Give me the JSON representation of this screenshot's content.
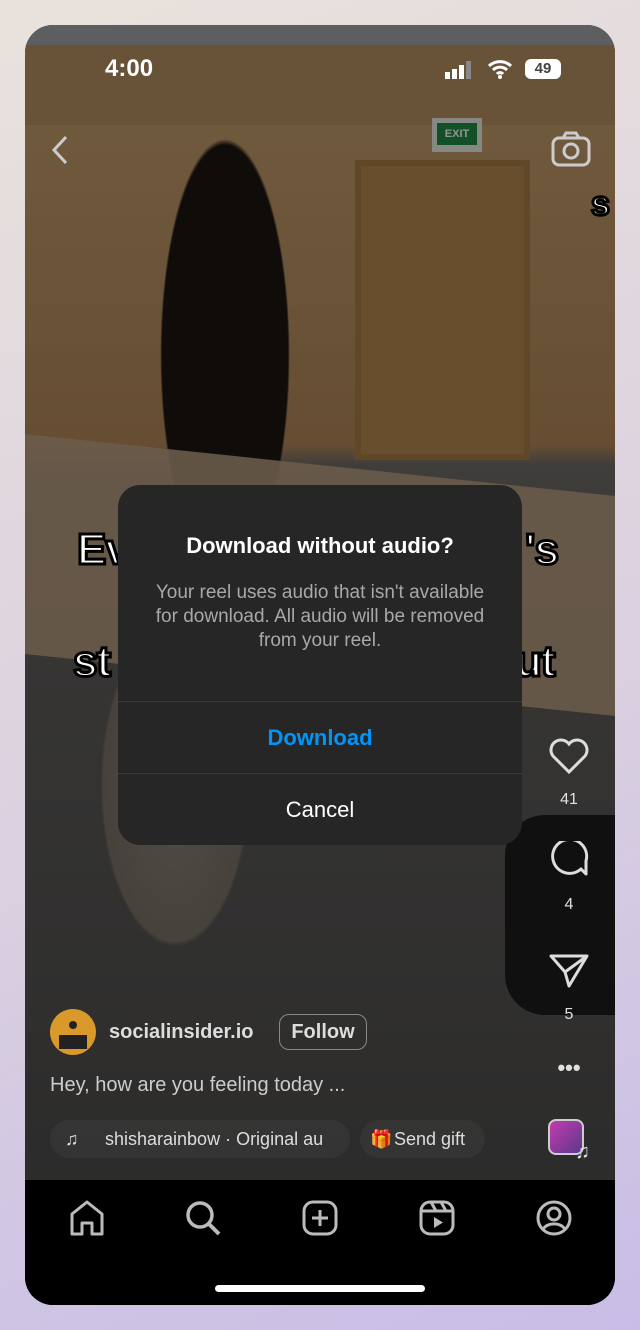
{
  "status_bar": {
    "time": "4:00",
    "battery": "49"
  },
  "video": {
    "caption_fragments": [
      "Ev",
      "'s",
      "st",
      "ut"
    ],
    "corner_text": "s",
    "exit_sign": "EXIT"
  },
  "dialog": {
    "title": "Download without audio?",
    "body": "Your reel uses audio that isn't available for download. All audio will be removed from your reel.",
    "download_label": "Download",
    "cancel_label": "Cancel",
    "accent": "#0095f6"
  },
  "actions": {
    "likes": "41",
    "comments": "4",
    "shares": "5"
  },
  "post": {
    "username": "socialinsider.io",
    "follow_label": "Follow",
    "caption": "Hey, how are you feeling today ...",
    "audio": "shisharainbow · Original au",
    "gift_label": "Send gift"
  },
  "nav": [
    "home-icon",
    "search-icon",
    "create-icon",
    "reels-icon",
    "profile-icon"
  ]
}
